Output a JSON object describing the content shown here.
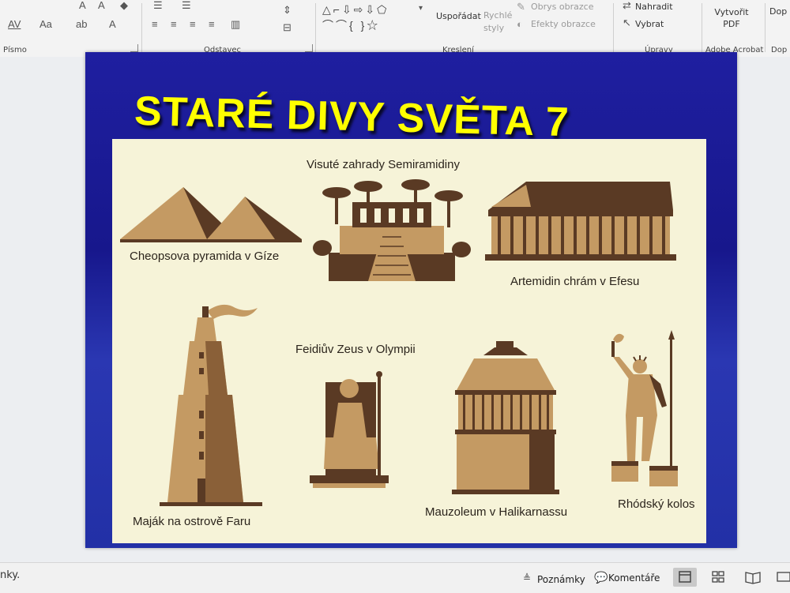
{
  "ribbon": {
    "font_group": {
      "label": "Písmo",
      "font_size_label": "Aa",
      "char_spacing_label": "AV",
      "text_color_label": "A"
    },
    "paragraph_group": {
      "label": "Odstavec"
    },
    "drawing_group": {
      "label": "Kreslení",
      "arrange_label": "Uspořádat",
      "quick_styles_label": "Rychlé styly",
      "shape_outline_label": "Obrys obrazce",
      "shape_effects_label": "Efekty obrazce"
    },
    "editing_group": {
      "label": "Úpravy",
      "replace_label": "Nahradit",
      "select_label": "Vybrat"
    },
    "acrobat_group": {
      "label": "Adobe Acrobat",
      "create_pdf_label": "Vytvořit PDF"
    },
    "extra_group": {
      "label_partial": "Dop",
      "button_partial": "Dop"
    }
  },
  "slide": {
    "title": "STARÉ DIVY SVĚTA 7",
    "wonders": [
      {
        "name": "Cheopsova pyramida v Gíze",
        "icon": "pyramids-illustration"
      },
      {
        "name": "Visuté zahrady Semiramidiny",
        "icon": "hanging-gardens-illustration"
      },
      {
        "name": "Artemidin chrám v Efesu",
        "icon": "temple-illustration"
      },
      {
        "name": "Maják na ostrově Faru",
        "icon": "lighthouse-illustration"
      },
      {
        "name": "Feidiův Zeus v Olympii",
        "icon": "zeus-statue-illustration"
      },
      {
        "name": "Mauzoleum v Halikarnassu",
        "icon": "mausoleum-illustration"
      },
      {
        "name": "Rhódský kolos",
        "icon": "colossus-illustration"
      }
    ]
  },
  "statusbar": {
    "left_text": "nky.",
    "notes_label": "Poznámky",
    "comments_label": "Komentáře"
  },
  "colors": {
    "slide_bg": "#1f1fa0",
    "title": "#ffff00",
    "panel_bg": "#f6f3d8",
    "art_dark": "#5a3a24",
    "art_light": "#c49a63"
  }
}
